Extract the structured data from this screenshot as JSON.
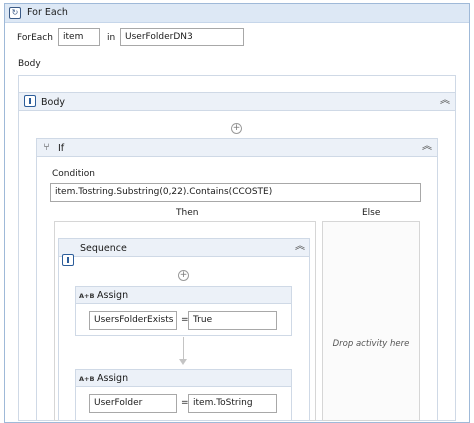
{
  "foreach": {
    "title": "For Each",
    "foreach_label": "ForEach",
    "item_value": "item",
    "in_label": "in",
    "collection_value": "UserFolderDN3",
    "body_label": "Body"
  },
  "body_sequence": {
    "title": "Body"
  },
  "if_activity": {
    "title": "If",
    "condition_label": "Condition",
    "condition_value": "item.Tostring.Substring(0,22).Contains(CCOSTE)",
    "then_label": "Then",
    "else_label": "Else",
    "else_hint": "Drop activity here"
  },
  "sequence": {
    "title": "Sequence"
  },
  "assigns": [
    {
      "title": "Assign",
      "icon_text": "A+B",
      "to_value": "UsersFolderExists",
      "equals": "=",
      "value": "True"
    },
    {
      "title": "Assign",
      "icon_text": "A+B",
      "to_value": "UserFolder",
      "equals": "=",
      "value": "item.ToString"
    }
  ],
  "icons": {
    "foreach_icon": "loop-icon",
    "sequence_icon": "sequence-icon",
    "if_icon": "branch-icon",
    "collapse_icon": "double-chevron-up-icon",
    "add_icon": "plus-circle-icon"
  }
}
